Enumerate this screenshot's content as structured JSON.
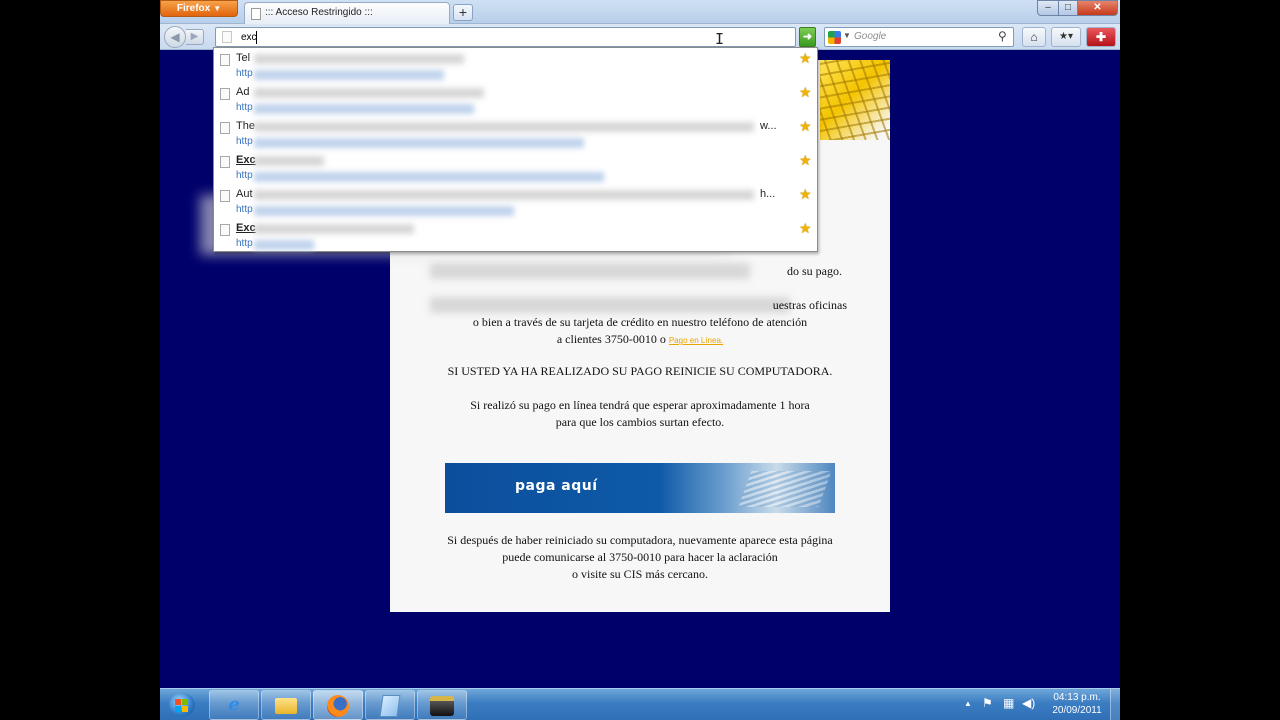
{
  "browser": {
    "menu_button": "Firefox",
    "tab_title": "::: Acceso Restringido :::",
    "new_tab": "+",
    "url_value": "exc",
    "search_placeholder": "Google",
    "window_controls": {
      "minimize": "–",
      "maximize": "□",
      "close": "✕"
    }
  },
  "autocomplete": {
    "items": [
      {
        "title": "Tel",
        "url": "http"
      },
      {
        "title": "Ad",
        "url": "http"
      },
      {
        "title": "The",
        "url": "http",
        "trailing": "w..."
      },
      {
        "title": "Exc",
        "url": "http",
        "bold": true
      },
      {
        "title": "Aut",
        "url": "http",
        "trailing": "h..."
      },
      {
        "title": "Exc",
        "url": "http",
        "bold": true
      }
    ]
  },
  "page": {
    "msg1_visible": "do su pago.",
    "msg2": {
      "line1_visible": "uestras oficinas",
      "line2": "o bien a través de su tarjeta de crédito en nuestro teléfono de atención",
      "line3": "a clientes 3750-0010 o",
      "link": "Pago en Línea."
    },
    "msg3": "SI USTED YA HA REALIZADO SU PAGO REINICIE SU COMPUTADORA.",
    "msg4": {
      "line1": "Si realizó su pago en línea tendrá que esperar aproximadamente 1 hora",
      "line2": "para que los cambios surtan efecto."
    },
    "banner_label": "paga aquí",
    "msg5": {
      "line1": "Si después de haber reiniciado su computadora, nuevamente aparece esta página",
      "line2": "puede comunicarse al 3750-0010 para hacer la aclaración",
      "line3": "o visite su CIS más cercano."
    }
  },
  "taskbar": {
    "clock_time": "04:13 p.m.",
    "clock_date": "20/09/2011",
    "ie_glyph": "e"
  }
}
